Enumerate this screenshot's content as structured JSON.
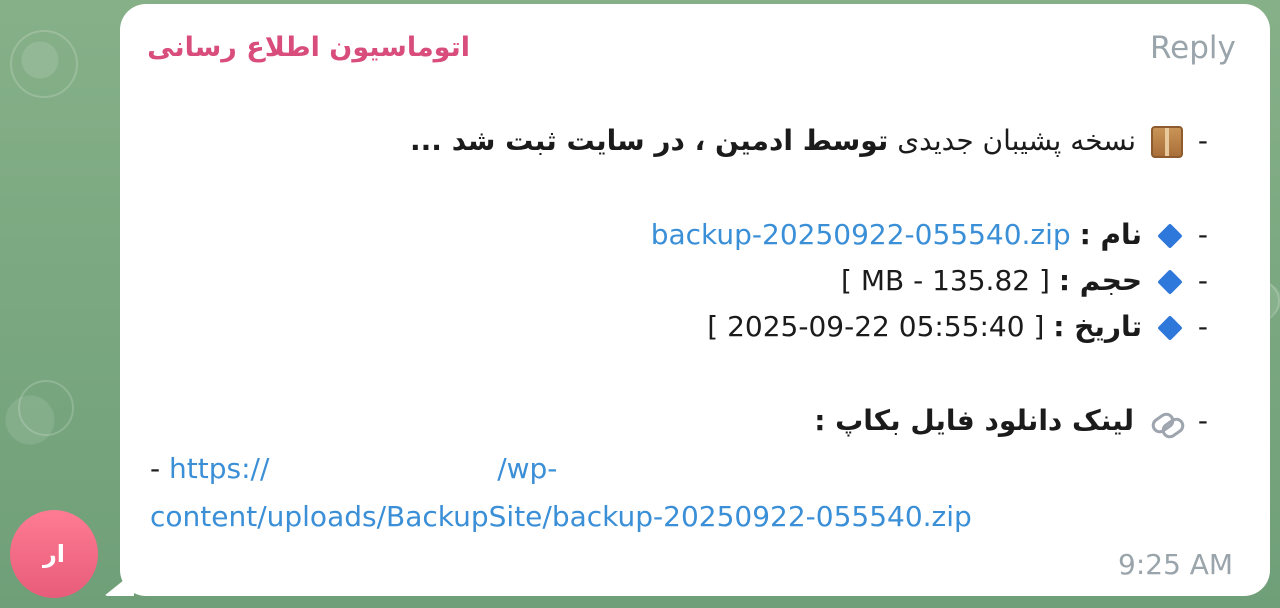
{
  "message": {
    "reply_label": "Reply",
    "sender_name": "اتوماسیون اطلاع رسانی",
    "avatar_initials": "ار",
    "time": "9:25 AM",
    "line1_prefix": "-",
    "line1_normal": "نسخه پشیبان جدیدی",
    "line1_bold": "توسط ادمین ، در سایت ثبت شد ...",
    "name_label": "نام :",
    "name_value": "backup-20250922-055540.zip",
    "size_label": "حجم :",
    "size_value": "[ MB - 135.82 ]",
    "date_label": "تاریخ :",
    "date_value": "[ 05:55:40 22-09-2025 ]",
    "download_label": "لینک دانلود فایل بکاپ :",
    "url_line1_prefix": "-",
    "url_line1_start": "https://",
    "url_line1_end": "/wp-",
    "url_line2": "content/uploads/BackupSite/backup-20250922-055540.zip"
  },
  "icons": {
    "package": "package-icon",
    "diamond": "blue-diamond-icon",
    "link": "link-icon"
  },
  "colors": {
    "accent": "#d84d7c",
    "link": "#3a8fd7",
    "avatar": "#e75c7a"
  }
}
